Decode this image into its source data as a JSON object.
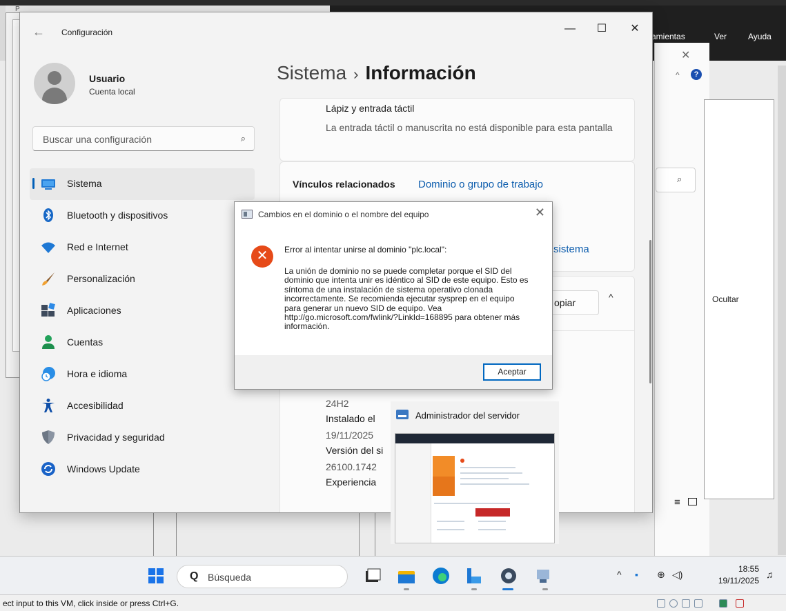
{
  "host": {
    "menu": [
      "ramientas",
      "Ver",
      "Ayuda"
    ],
    "partial_char": "P",
    "status_text": "ect input to this VM, click inside or press Ctrl+G."
  },
  "background": {
    "close_glyph": "✕",
    "ocultar": "Ocultar"
  },
  "settings": {
    "title": "Configuración",
    "user": {
      "name": "Usuario",
      "account": "Cuenta local"
    },
    "search_placeholder": "Buscar una configuración",
    "nav": [
      {
        "label": "Sistema",
        "icon": "display-icon"
      },
      {
        "label": "Bluetooth y dispositivos",
        "icon": "bluetooth-icon"
      },
      {
        "label": "Red e Internet",
        "icon": "wifi-icon"
      },
      {
        "label": "Personalización",
        "icon": "brush-icon"
      },
      {
        "label": "Aplicaciones",
        "icon": "apps-icon"
      },
      {
        "label": "Cuentas",
        "icon": "person-icon"
      },
      {
        "label": "Hora e idioma",
        "icon": "clock-globe-icon"
      },
      {
        "label": "Accesibilidad",
        "icon": "accessibility-icon"
      },
      {
        "label": "Privacidad y seguridad",
        "icon": "shield-icon"
      },
      {
        "label": "Windows Update",
        "icon": "update-icon"
      }
    ],
    "breadcrumb": {
      "parent": "Sistema",
      "separator": "›",
      "current": "Información"
    },
    "pen": {
      "title": "Lápiz y entrada táctil",
      "desc": "La entrada táctil o manuscrita no está disponible para esta pantalla"
    },
    "related": {
      "label": "Vínculos relacionados",
      "link1": "Dominio o grupo de trabajo",
      "link2": "sistema"
    },
    "copy_label": "opiar",
    "info": [
      "24H2",
      "Instalado el",
      "19/11/2025",
      "Versión del si",
      "26100.1742",
      "Experiencia"
    ]
  },
  "dialog": {
    "title": "Cambios en el dominio o el nombre del equipo",
    "heading": "Error al intentar unirse al dominio \"plc.local\":",
    "message": "La unión de dominio no se puede completar porque el SID del dominio que intenta unir es idéntico al SID de este equipo. Esto es síntoma de una instalación de sistema operativo clonada incorrectamente. Se recomienda ejecutar sysprep en el equipo para generar un nuevo SID de equipo. Vea http://go.microsoft.com/fwlink/?LinkId=168895 para obtener más información.",
    "ok": "Aceptar"
  },
  "thumbnail": {
    "title": "Administrador del servidor"
  },
  "taskbar": {
    "search_label": "Búsqueda",
    "time": "18:55",
    "date": "19/11/2025"
  },
  "colors": {
    "accent": "#005fb8",
    "error": "#e64a19",
    "link": "#0b5cad"
  }
}
